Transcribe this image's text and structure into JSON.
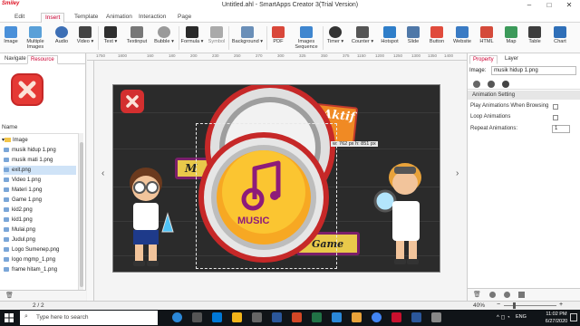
{
  "window": {
    "app_logo": "Smiley",
    "title": "Untitled.ahl - SmartApps Creator 3(Trial Version)",
    "minimize": "–",
    "maximize": "□",
    "close": "✕"
  },
  "menu": {
    "tabs": [
      {
        "label": "Edit",
        "active": false
      },
      {
        "label": "Insert",
        "active": true
      },
      {
        "label": "Template",
        "active": false
      },
      {
        "label": "Animation",
        "active": false
      },
      {
        "label": "Interaction",
        "active": false
      },
      {
        "label": "Page",
        "active": false
      }
    ]
  },
  "ribbon": {
    "items": [
      {
        "label": "Image",
        "icon": "image-icon",
        "color": "#4a90d9",
        "dropdown": false
      },
      {
        "label": "Multiple Images",
        "icon": "images-icon",
        "color": "#5aa0d8",
        "dropdown": false
      },
      {
        "label": "Audio",
        "icon": "audio-icon",
        "color": "#3d6fb5",
        "dropdown": false
      },
      {
        "label": "Video",
        "icon": "video-icon",
        "color": "#444444",
        "dropdown": true
      },
      {
        "label": "Text",
        "icon": "text-icon",
        "color": "#2f2f2f",
        "dropdown": true
      },
      {
        "label": "Textinput",
        "icon": "textinput-icon",
        "color": "#777777",
        "dropdown": false
      },
      {
        "label": "Bubble",
        "icon": "bubble-icon",
        "color": "#9a9a9a",
        "dropdown": true
      },
      {
        "label": "Formula",
        "icon": "formula-icon",
        "color": "#2a2a2a",
        "dropdown": true
      },
      {
        "label": "Symbol",
        "icon": "symbol-icon",
        "color": "#aaaaaa",
        "dropdown": false
      },
      {
        "label": "Background",
        "icon": "background-icon",
        "color": "#6a8fb8",
        "dropdown": true
      },
      {
        "label": "PDF",
        "icon": "pdf-icon",
        "color": "#d9473a",
        "dropdown": false
      },
      {
        "label": "Images Sequence",
        "icon": "images-sequence-icon",
        "color": "#3f86cf",
        "dropdown": false
      },
      {
        "label": "Timer",
        "icon": "timer-icon",
        "color": "#333333",
        "dropdown": true
      },
      {
        "label": "Counter",
        "icon": "counter-icon",
        "color": "#555555",
        "dropdown": true
      },
      {
        "label": "Hotspot",
        "icon": "hotspot-icon",
        "color": "#2f7ec9",
        "dropdown": false
      },
      {
        "label": "Slide",
        "icon": "slide-icon",
        "color": "#4f78a8",
        "dropdown": false
      },
      {
        "label": "Button",
        "icon": "button-icon",
        "color": "#e04b3c",
        "dropdown": false
      },
      {
        "label": "Website",
        "icon": "website-icon",
        "color": "#3a7bc4",
        "dropdown": false
      },
      {
        "label": "HTML",
        "icon": "html-icon",
        "color": "#d44a3a",
        "dropdown": false
      },
      {
        "label": "Map",
        "icon": "map-icon",
        "color": "#3c9a5a",
        "dropdown": false
      },
      {
        "label": "Table",
        "icon": "table-icon",
        "color": "#3e3e3e",
        "dropdown": false
      },
      {
        "label": "Chart",
        "icon": "chart-icon",
        "color": "#2f6fb8",
        "dropdown": false
      }
    ]
  },
  "left_panel": {
    "tabs": [
      "Navigate",
      "Resource"
    ],
    "active_tab": "Resource",
    "names_header": "Name",
    "tree": {
      "folder": "Image",
      "items": [
        {
          "label": "musik hidup 1.png",
          "selected": false
        },
        {
          "label": "musik mati 1.png",
          "selected": false
        },
        {
          "label": "exit.png",
          "selected": true
        },
        {
          "label": "Video 1.png",
          "selected": false
        },
        {
          "label": "Materi 1.png",
          "selected": false
        },
        {
          "label": "Game 1.png",
          "selected": false
        },
        {
          "label": "kid2.png",
          "selected": false
        },
        {
          "label": "kid1.png",
          "selected": false
        },
        {
          "label": "Mulai.png",
          "selected": false
        },
        {
          "label": "Judul.png",
          "selected": false
        },
        {
          "label": "Logo Sumenep.png",
          "selected": false
        },
        {
          "label": "logo mgmp_1.png",
          "selected": false
        },
        {
          "label": "frame hitam_1.png",
          "selected": false
        }
      ]
    }
  },
  "canvas": {
    "ruler_ticks": [
      "160",
      "180",
      "200",
      "230",
      "250",
      "270",
      "300",
      "325",
      "350",
      "375",
      "1150",
      "1200",
      "1250",
      "1300",
      "1350",
      "1400",
      "1750",
      "1800"
    ],
    "selection_tooltip": "w: 762 px  h: 851 px",
    "stage_labels": {
      "music": "MUSIC",
      "game": "Game",
      "aktif": "Aktif",
      "materi_partial": "M"
    },
    "prev_arrow": "‹",
    "next_arrow": "›"
  },
  "statusbar": {
    "page": "2 / 2",
    "zoom": "40%"
  },
  "right_panel": {
    "tabs": [
      "Property",
      "Layer"
    ],
    "active_tab": "Property",
    "image_label": "Image:",
    "image_value": "musik hidup 1.png",
    "section": "Animation Setting",
    "properties": [
      {
        "label": "Play Animations When Browsing",
        "checked": false
      },
      {
        "label": "Loop Animations",
        "checked": false
      }
    ],
    "repeat_label": "Repeat Animations:",
    "repeat_value": "1"
  },
  "taskbar": {
    "search_placeholder": "Type here to search",
    "language": "ENG",
    "time": "11:02 PM",
    "date": "6/27/2020"
  },
  "colors": {
    "accent": "#c8102e",
    "selection": "#cfe3f7",
    "stage_bg": "#2b2b2b"
  }
}
